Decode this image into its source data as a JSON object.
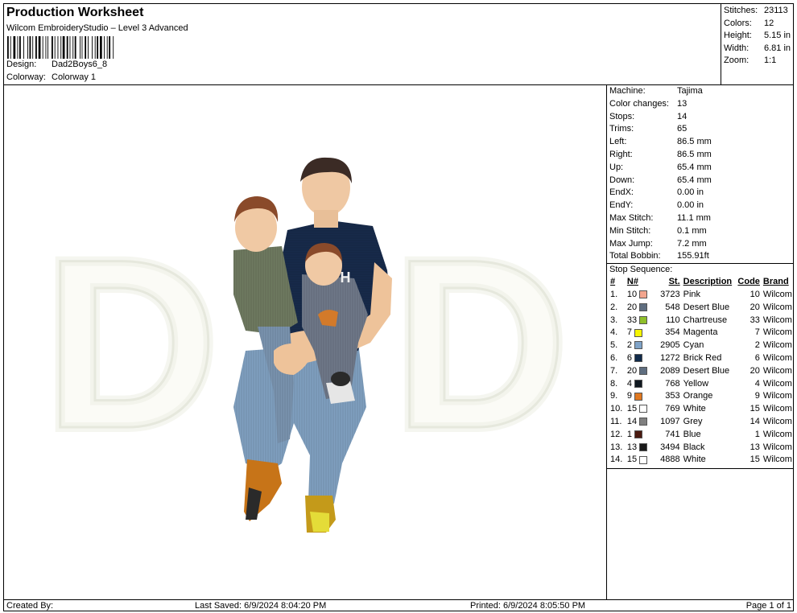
{
  "header": {
    "title": "Production Worksheet",
    "subtitle": "Wilcom EmbroideryStudio – Level 3 Advanced",
    "design_label": "Design:",
    "design_value": "Dad2Boys6_8",
    "colorway_label": "Colorway:",
    "colorway_value": "Colorway 1"
  },
  "summary": [
    {
      "label": "Stitches:",
      "value": "23113"
    },
    {
      "label": "Colors:",
      "value": "12"
    },
    {
      "label": "Height:",
      "value": "5.15 in"
    },
    {
      "label": "Width:",
      "value": "6.81 in"
    },
    {
      "label": "Zoom:",
      "value": "1:1"
    }
  ],
  "machine_info": [
    {
      "label": "Machine:",
      "value": "Tajima"
    },
    {
      "label": "Color changes:",
      "value": "13"
    },
    {
      "label": "Stops:",
      "value": "14"
    },
    {
      "label": "Trims:",
      "value": "65"
    },
    {
      "label": "Left:",
      "value": "86.5 mm"
    },
    {
      "label": "Right:",
      "value": "86.5 mm"
    },
    {
      "label": "Up:",
      "value": "65.4 mm"
    },
    {
      "label": "Down:",
      "value": "65.4 mm"
    },
    {
      "label": "EndX:",
      "value": "0.00 in"
    },
    {
      "label": "EndY:",
      "value": "0.00 in"
    },
    {
      "label": "Max Stitch:",
      "value": "11.1 mm"
    },
    {
      "label": "Min Stitch:",
      "value": "0.1 mm"
    },
    {
      "label": "Max Jump:",
      "value": "7.2 mm"
    },
    {
      "label": "Total Bobbin:",
      "value": "155.91ft"
    }
  ],
  "stop_sequence": {
    "title": "Stop Sequence:",
    "headers": {
      "idx": "#",
      "n": "N#",
      "st": "St.",
      "desc": "Description",
      "code": "Code",
      "brand": "Brand"
    },
    "rows": [
      {
        "idx": "1.",
        "n": "10",
        "color": "#f2a58e",
        "st": "3723",
        "desc": "Pink",
        "code": "10",
        "brand": "Wilcom"
      },
      {
        "idx": "2.",
        "n": "20",
        "color": "#5f6e80",
        "st": "548",
        "desc": "Desert Blue",
        "code": "20",
        "brand": "Wilcom"
      },
      {
        "idx": "3.",
        "n": "33",
        "color": "#8fbf2a",
        "st": "110",
        "desc": "Chartreuse",
        "code": "33",
        "brand": "Wilcom"
      },
      {
        "idx": "4.",
        "n": "7",
        "color": "#f5f500",
        "st": "354",
        "desc": "Magenta",
        "code": "7",
        "brand": "Wilcom"
      },
      {
        "idx": "5.",
        "n": "2",
        "color": "#7fa3c8",
        "st": "2905",
        "desc": "Cyan",
        "code": "2",
        "brand": "Wilcom"
      },
      {
        "idx": "6.",
        "n": "6",
        "color": "#102a4a",
        "st": "1272",
        "desc": "Brick Red",
        "code": "6",
        "brand": "Wilcom"
      },
      {
        "idx": "7.",
        "n": "20",
        "color": "#5f6e80",
        "st": "2089",
        "desc": "Desert Blue",
        "code": "20",
        "brand": "Wilcom"
      },
      {
        "idx": "8.",
        "n": "4",
        "color": "#101820",
        "st": "768",
        "desc": "Yellow",
        "code": "4",
        "brand": "Wilcom"
      },
      {
        "idx": "9.",
        "n": "9",
        "color": "#e07820",
        "st": "353",
        "desc": "Orange",
        "code": "9",
        "brand": "Wilcom"
      },
      {
        "idx": "10.",
        "n": "15",
        "color": "#ffffff",
        "st": "769",
        "desc": "White",
        "code": "15",
        "brand": "Wilcom"
      },
      {
        "idx": "11.",
        "n": "14",
        "color": "#808080",
        "st": "1097",
        "desc": "Grey",
        "code": "14",
        "brand": "Wilcom"
      },
      {
        "idx": "12.",
        "n": "1",
        "color": "#4a1a10",
        "st": "741",
        "desc": "Blue",
        "code": "1",
        "brand": "Wilcom"
      },
      {
        "idx": "13.",
        "n": "13",
        "color": "#1a1a1a",
        "st": "3494",
        "desc": "Black",
        "code": "13",
        "brand": "Wilcom"
      },
      {
        "idx": "14.",
        "n": "15",
        "color": "#ffffff",
        "st": "4888",
        "desc": "White",
        "code": "15",
        "brand": "Wilcom"
      }
    ]
  },
  "design_art": {
    "letter_left": "D",
    "letter_right": "D",
    "shirt_letter": "H"
  },
  "footer": {
    "created_by": "Created By:",
    "last_saved": "Last Saved: 6/9/2024 8:04:20 PM",
    "printed": "Printed: 6/9/2024 8:05:50 PM",
    "page": "Page 1 of 1"
  }
}
